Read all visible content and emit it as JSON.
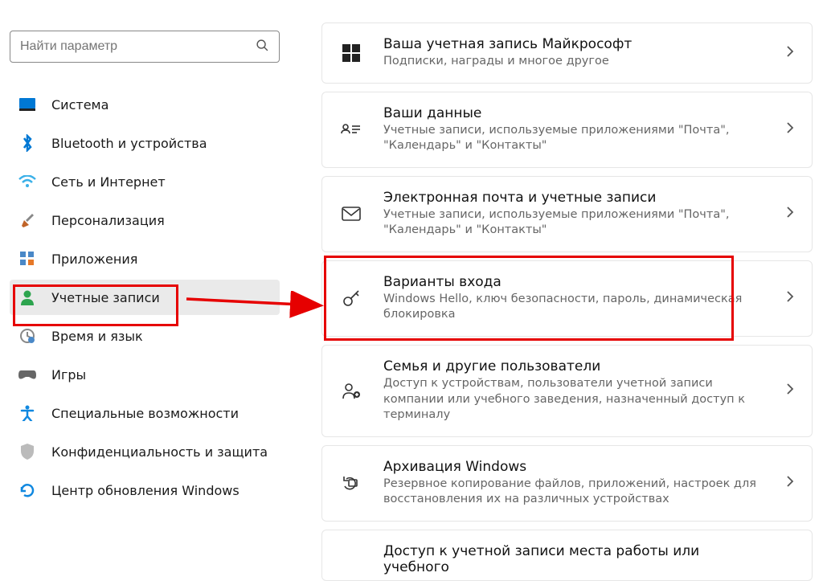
{
  "search": {
    "placeholder": "Найти параметр"
  },
  "sidebar": {
    "items": [
      {
        "label": "Система"
      },
      {
        "label": "Bluetooth и устройства"
      },
      {
        "label": "Сеть и Интернет"
      },
      {
        "label": "Персонализация"
      },
      {
        "label": "Приложения"
      },
      {
        "label": "Учетные записи"
      },
      {
        "label": "Время и язык"
      },
      {
        "label": "Игры"
      },
      {
        "label": "Специальные возможности"
      },
      {
        "label": "Конфиденциальность и защита"
      },
      {
        "label": "Центр обновления Windows"
      }
    ]
  },
  "main": {
    "cards": [
      {
        "title": "Ваша учетная запись Майкрософт",
        "desc": "Подписки, награды и многое другое"
      },
      {
        "title": "Ваши данные",
        "desc": "Учетные записи, используемые приложениями \"Почта\", \"Календарь\" и \"Контакты\""
      },
      {
        "title": "Электронная почта и учетные записи",
        "desc": "Учетные записи, используемые приложениями \"Почта\", \"Календарь\" и \"Контакты\""
      },
      {
        "title": "Варианты входа",
        "desc": "Windows Hello, ключ безопасности, пароль, динамическая блокировка"
      },
      {
        "title": "Семья и другие пользователи",
        "desc": "Доступ к устройствам, пользователи учетной записи компании или учебного заведения, назначенный доступ к терминалу"
      },
      {
        "title": "Архивация Windows",
        "desc": "Резервное копирование файлов, приложений, настроек для восстановления их на различных устройствах"
      },
      {
        "title": "Доступ к учетной записи места работы или учебного",
        "desc": ""
      }
    ]
  }
}
